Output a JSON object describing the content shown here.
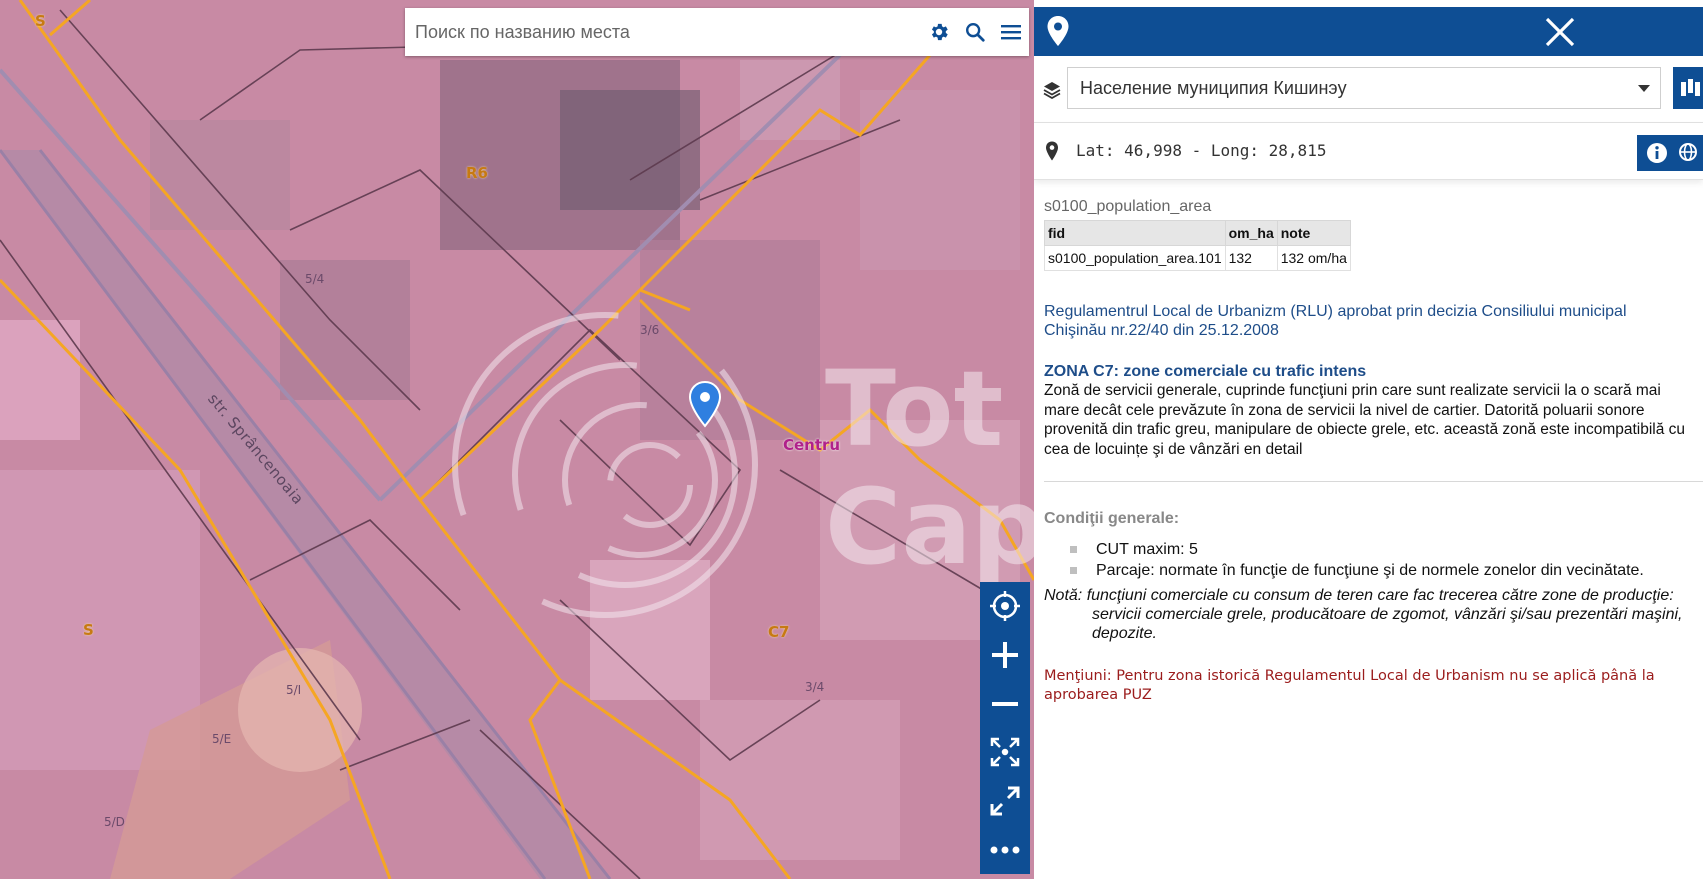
{
  "search": {
    "placeholder": "Поиск по названию места"
  },
  "map": {
    "zone_labels": [
      "S",
      "R6",
      "S",
      "C7"
    ],
    "parcel_labels": [
      "5/4",
      "3/6",
      "5/I",
      "5/E",
      "5/D",
      "3/4"
    ],
    "street_label": "str. Sprâncenoaia",
    "district_label": "Centru",
    "watermark_text": "Tot Cap"
  },
  "tools": {
    "icons": [
      "locate-icon",
      "zoom-in-icon",
      "zoom-out-icon",
      "full-extent-icon",
      "fullscreen-icon",
      "more-icon"
    ]
  },
  "panel": {
    "layer_select": "Население муниципия Кишинэу",
    "coordinates": "Lat: 46,998 - Long: 28,815",
    "result_title": "s0100_population_area",
    "table": {
      "headers": [
        "fid",
        "om_ha",
        "note"
      ],
      "rows": [
        [
          "s0100_population_area.101",
          "132",
          "132 om/ha"
        ]
      ]
    },
    "rlu_text": "Regulamentrul Local de Urbanizm (RLU) aprobat prin decizia Consiliului municipal Chişinău nr.22/40 din 25.12.2008",
    "zone_title": "ZONA C7: zone comerciale cu trafic intens",
    "zone_description": "Zonă de servicii generale, cuprinde funcţiuni prin care sunt realizate servicii la o scară mai mare decât cele prevăzute în zona de servicii la nivel de cartier. Datorită poluarii sonore provenită din trafic greu, manipulare de obiecte grele, etc. această zonă este incompatibilă cu cea de locuințe şi de vânzări en detail",
    "conditions_title": "Condiţii generale:",
    "conditions": [
      "CUT maxim: 5",
      "Parcaje: normate în funcţie de funcţiune şi de normele zonelor din vecinătate."
    ],
    "nota": "Notă: funcţiuni comerciale cu consum de teren care fac trecerea către zone de producţie: servicii comerciale grele, producătoare de zgomot, vânzări şi/sau prezentări maşini, depozite.",
    "mentiuni": "Menţiuni: Pentru zona istorică Regulamentul Local de Urbanism nu se aplică până la aprobarea PUZ"
  },
  "colors": {
    "header_blue": "#0e4e94",
    "zone_boundary": "#f5a623",
    "overlay_pink": "#d98fb5",
    "link_blue": "#1e4d89",
    "note_red": "#9b1c1c"
  }
}
